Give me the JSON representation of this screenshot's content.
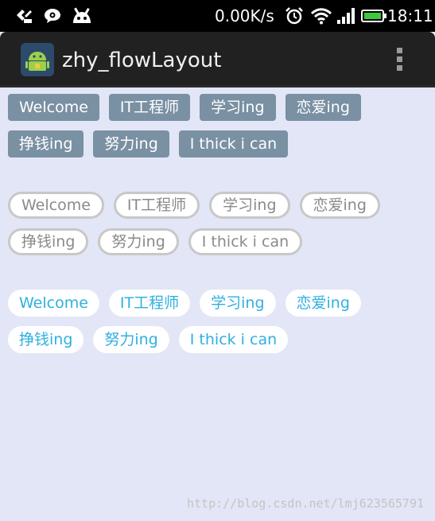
{
  "status_bar": {
    "net_speed": "0.00K/s",
    "time": "18:11"
  },
  "action_bar": {
    "title": "zhy_flowLayout"
  },
  "flow_solid": {
    "tags": [
      "Welcome",
      "IT工程师",
      "学习ing",
      "恋爱ing",
      "挣钱ing",
      "努力ing",
      "I thick i can"
    ]
  },
  "flow_outline": {
    "tags": [
      "Welcome",
      "IT工程师",
      "学习ing",
      "恋爱ing",
      "挣钱ing",
      "努力ing",
      "I thick i can"
    ]
  },
  "flow_white": {
    "tags": [
      "Welcome",
      "IT工程师",
      "学习ing",
      "恋爱ing",
      "挣钱ing",
      "努力ing",
      "I thick i can"
    ]
  },
  "watermark": "http://blog.csdn.net/lmj623565791",
  "colors": {
    "background": "#e2e6f6",
    "solid_tag": "#7a90a3",
    "text_blue": "#2fb0e0",
    "battery_green": "#3ec83e"
  }
}
